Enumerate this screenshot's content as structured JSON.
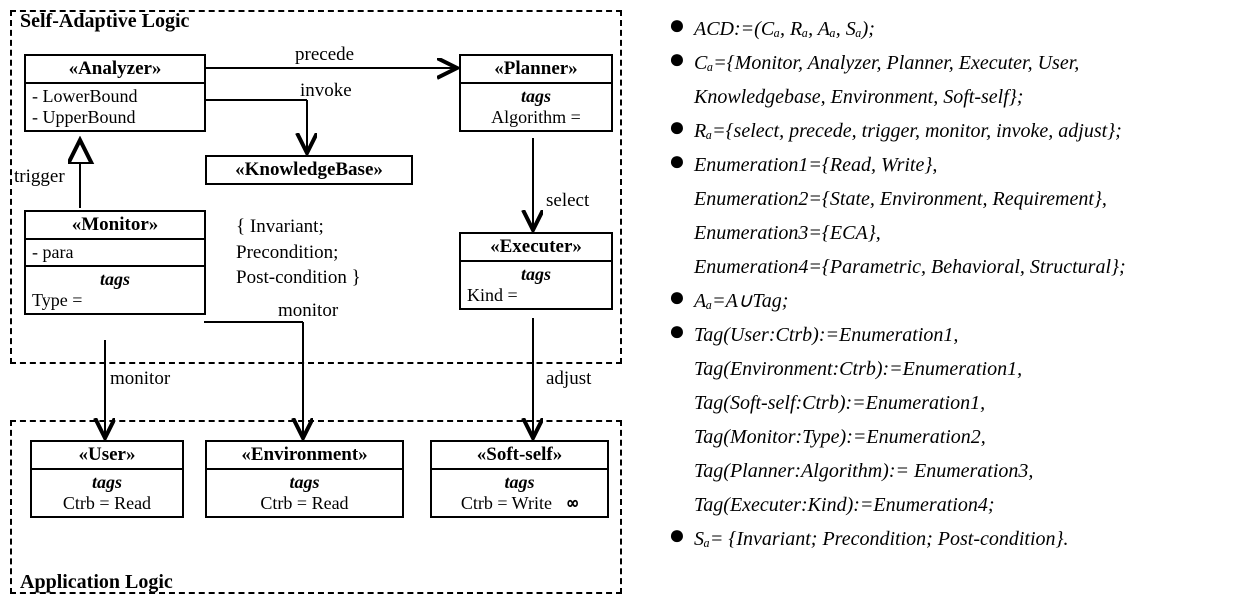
{
  "groups": {
    "top_title": "Self-Adaptive Logic",
    "bottom_title": "Application Logic"
  },
  "analyzer": {
    "stereo": "«Analyzer»",
    "a1": "-   LowerBound",
    "a2": "-   UpperBound"
  },
  "planner": {
    "stereo": "«Planner»",
    "tags_word": "tags",
    "algo": "Algorithm ="
  },
  "kb": {
    "stereo": "«KnowledgeBase»"
  },
  "monitor": {
    "stereo": "«Monitor»",
    "para": "-   para",
    "tags_word": "tags",
    "type": "Type ="
  },
  "executer": {
    "stereo": "«Executer»",
    "tags_word": "tags",
    "kind": "Kind ="
  },
  "user": {
    "stereo": "«User»",
    "tags_word": "tags",
    "ctrb": "Ctrb = Read"
  },
  "env": {
    "stereo": "«Environment»",
    "tags_word": "tags",
    "ctrb": "Ctrb = Read"
  },
  "soft": {
    "stereo": "«Soft-self»",
    "tags_word": "tags",
    "ctrb": "Ctrb = Write"
  },
  "edge_labels": {
    "precede": "precede",
    "invoke": "invoke",
    "trigger": "trigger",
    "select": "select",
    "monitor1": "monitor",
    "monitor2": "monitor",
    "adjust": "adjust"
  },
  "constraint": {
    "l1": "{ Invariant;",
    "l2": "  Precondition;",
    "l3": "  Post-condition }"
  },
  "rules": [
    "ACD:=(Cₐ, Rₐ, Aₐ, Sₐ);",
    "Cₐ={Monitor, Analyzer, Planner, Executer, User,\n       Knowledgebase, Environment, Soft-self};",
    "Rₐ={select, precede, trigger, monitor, invoke, adjust};",
    "Enumeration1={Read, Write},\nEnumeration2={State, Environment, Requirement},\nEnumeration3={ECA},\nEnumeration4={Parametric, Behavioral, Structural};",
    "Aₐ=A∪Tag;",
    "Tag(User:Ctrb):=Enumeration1,\nTag(Environment:Ctrb):=Enumeration1,\nTag(Soft-self:Ctrb):=Enumeration1,\nTag(Monitor:Type):=Enumeration2,\nTag(Planner:Algorithm):= Enumeration3,\nTag(Executer:Kind):=Enumeration4;",
    "Sₐ= {Invariant; Precondition; Post-condition}."
  ]
}
